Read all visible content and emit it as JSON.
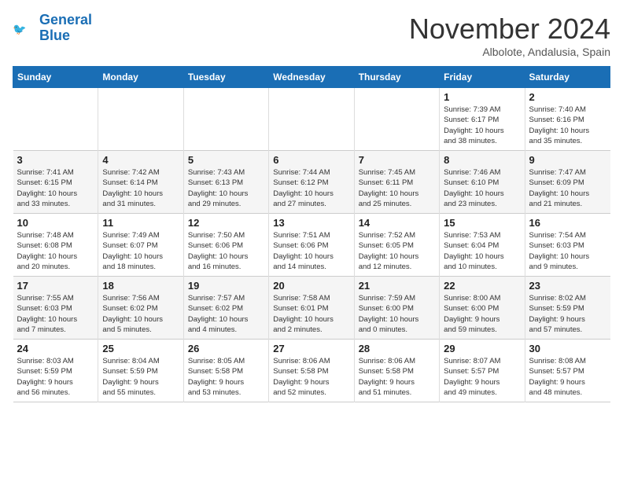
{
  "header": {
    "logo_line1": "General",
    "logo_line2": "Blue",
    "month": "November 2024",
    "location": "Albolote, Andalusia, Spain"
  },
  "weekdays": [
    "Sunday",
    "Monday",
    "Tuesday",
    "Wednesday",
    "Thursday",
    "Friday",
    "Saturday"
  ],
  "weeks": [
    [
      {
        "num": "",
        "info": ""
      },
      {
        "num": "",
        "info": ""
      },
      {
        "num": "",
        "info": ""
      },
      {
        "num": "",
        "info": ""
      },
      {
        "num": "",
        "info": ""
      },
      {
        "num": "1",
        "info": "Sunrise: 7:39 AM\nSunset: 6:17 PM\nDaylight: 10 hours\nand 38 minutes."
      },
      {
        "num": "2",
        "info": "Sunrise: 7:40 AM\nSunset: 6:16 PM\nDaylight: 10 hours\nand 35 minutes."
      }
    ],
    [
      {
        "num": "3",
        "info": "Sunrise: 7:41 AM\nSunset: 6:15 PM\nDaylight: 10 hours\nand 33 minutes."
      },
      {
        "num": "4",
        "info": "Sunrise: 7:42 AM\nSunset: 6:14 PM\nDaylight: 10 hours\nand 31 minutes."
      },
      {
        "num": "5",
        "info": "Sunrise: 7:43 AM\nSunset: 6:13 PM\nDaylight: 10 hours\nand 29 minutes."
      },
      {
        "num": "6",
        "info": "Sunrise: 7:44 AM\nSunset: 6:12 PM\nDaylight: 10 hours\nand 27 minutes."
      },
      {
        "num": "7",
        "info": "Sunrise: 7:45 AM\nSunset: 6:11 PM\nDaylight: 10 hours\nand 25 minutes."
      },
      {
        "num": "8",
        "info": "Sunrise: 7:46 AM\nSunset: 6:10 PM\nDaylight: 10 hours\nand 23 minutes."
      },
      {
        "num": "9",
        "info": "Sunrise: 7:47 AM\nSunset: 6:09 PM\nDaylight: 10 hours\nand 21 minutes."
      }
    ],
    [
      {
        "num": "10",
        "info": "Sunrise: 7:48 AM\nSunset: 6:08 PM\nDaylight: 10 hours\nand 20 minutes."
      },
      {
        "num": "11",
        "info": "Sunrise: 7:49 AM\nSunset: 6:07 PM\nDaylight: 10 hours\nand 18 minutes."
      },
      {
        "num": "12",
        "info": "Sunrise: 7:50 AM\nSunset: 6:06 PM\nDaylight: 10 hours\nand 16 minutes."
      },
      {
        "num": "13",
        "info": "Sunrise: 7:51 AM\nSunset: 6:06 PM\nDaylight: 10 hours\nand 14 minutes."
      },
      {
        "num": "14",
        "info": "Sunrise: 7:52 AM\nSunset: 6:05 PM\nDaylight: 10 hours\nand 12 minutes."
      },
      {
        "num": "15",
        "info": "Sunrise: 7:53 AM\nSunset: 6:04 PM\nDaylight: 10 hours\nand 10 minutes."
      },
      {
        "num": "16",
        "info": "Sunrise: 7:54 AM\nSunset: 6:03 PM\nDaylight: 10 hours\nand 9 minutes."
      }
    ],
    [
      {
        "num": "17",
        "info": "Sunrise: 7:55 AM\nSunset: 6:03 PM\nDaylight: 10 hours\nand 7 minutes."
      },
      {
        "num": "18",
        "info": "Sunrise: 7:56 AM\nSunset: 6:02 PM\nDaylight: 10 hours\nand 5 minutes."
      },
      {
        "num": "19",
        "info": "Sunrise: 7:57 AM\nSunset: 6:02 PM\nDaylight: 10 hours\nand 4 minutes."
      },
      {
        "num": "20",
        "info": "Sunrise: 7:58 AM\nSunset: 6:01 PM\nDaylight: 10 hours\nand 2 minutes."
      },
      {
        "num": "21",
        "info": "Sunrise: 7:59 AM\nSunset: 6:00 PM\nDaylight: 10 hours\nand 0 minutes."
      },
      {
        "num": "22",
        "info": "Sunrise: 8:00 AM\nSunset: 6:00 PM\nDaylight: 9 hours\nand 59 minutes."
      },
      {
        "num": "23",
        "info": "Sunrise: 8:02 AM\nSunset: 5:59 PM\nDaylight: 9 hours\nand 57 minutes."
      }
    ],
    [
      {
        "num": "24",
        "info": "Sunrise: 8:03 AM\nSunset: 5:59 PM\nDaylight: 9 hours\nand 56 minutes."
      },
      {
        "num": "25",
        "info": "Sunrise: 8:04 AM\nSunset: 5:59 PM\nDaylight: 9 hours\nand 55 minutes."
      },
      {
        "num": "26",
        "info": "Sunrise: 8:05 AM\nSunset: 5:58 PM\nDaylight: 9 hours\nand 53 minutes."
      },
      {
        "num": "27",
        "info": "Sunrise: 8:06 AM\nSunset: 5:58 PM\nDaylight: 9 hours\nand 52 minutes."
      },
      {
        "num": "28",
        "info": "Sunrise: 8:06 AM\nSunset: 5:58 PM\nDaylight: 9 hours\nand 51 minutes."
      },
      {
        "num": "29",
        "info": "Sunrise: 8:07 AM\nSunset: 5:57 PM\nDaylight: 9 hours\nand 49 minutes."
      },
      {
        "num": "30",
        "info": "Sunrise: 8:08 AM\nSunset: 5:57 PM\nDaylight: 9 hours\nand 48 minutes."
      }
    ]
  ]
}
